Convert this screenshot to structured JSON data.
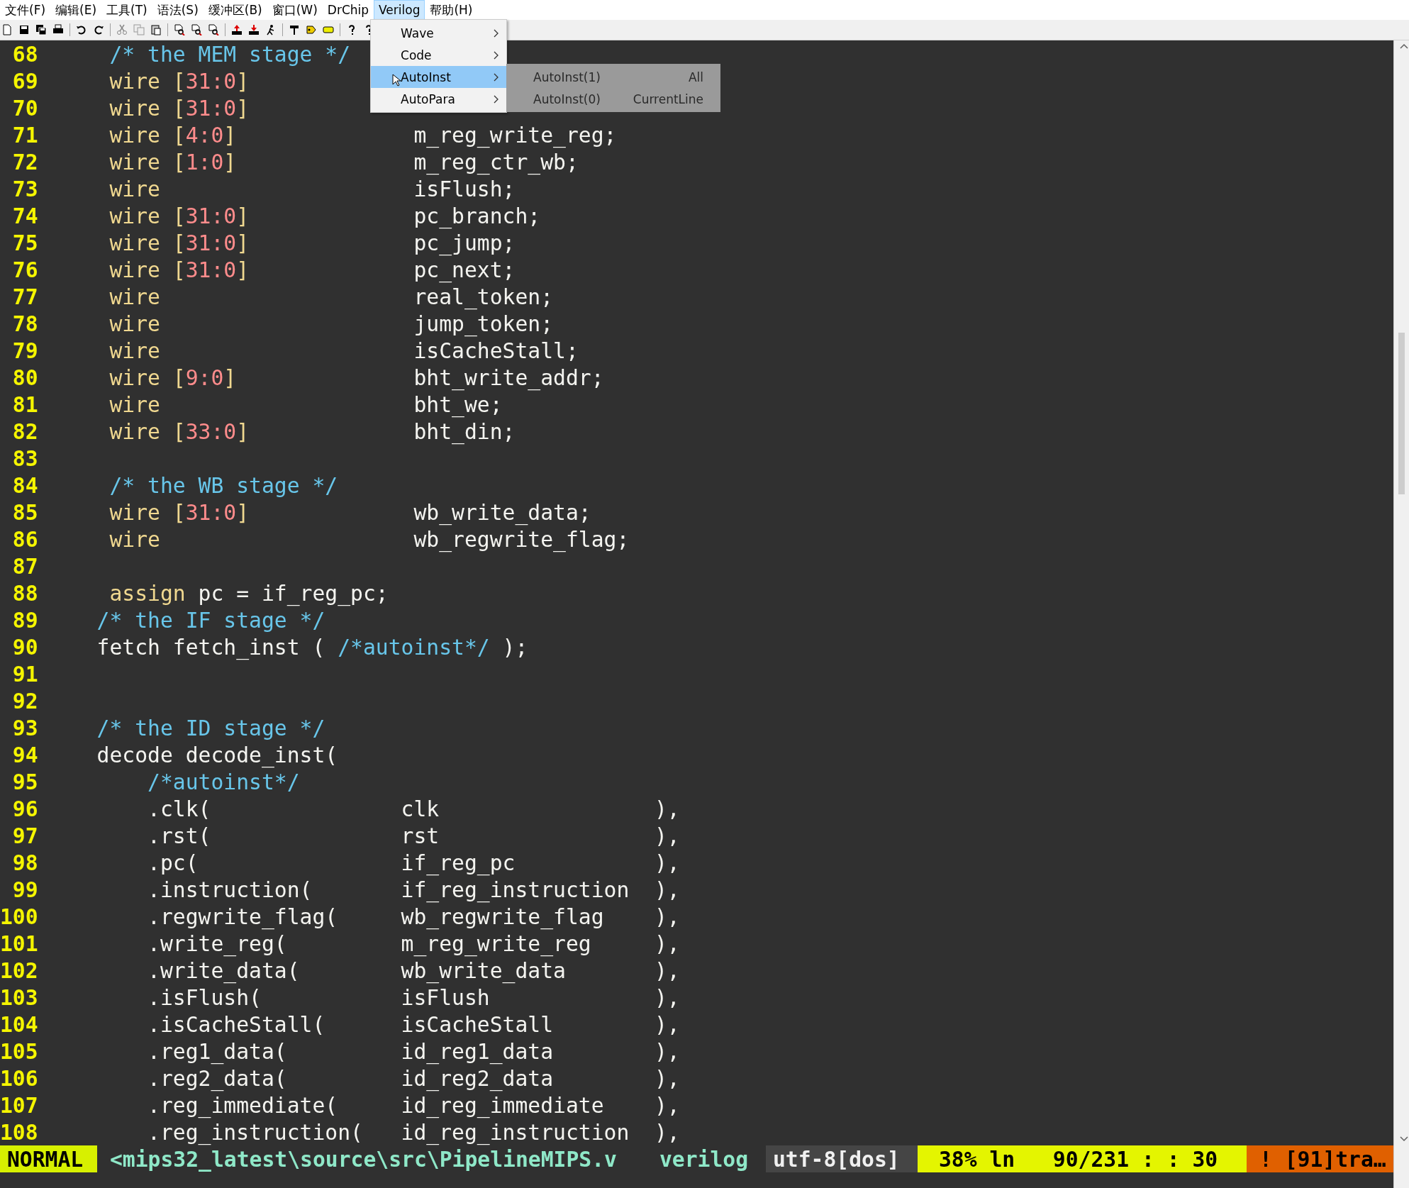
{
  "menu_bar": [
    {
      "label": "文件(F)",
      "selected": false
    },
    {
      "label": "编辑(E)",
      "selected": false
    },
    {
      "label": "工具(T)",
      "selected": false
    },
    {
      "label": "语法(S)",
      "selected": false
    },
    {
      "label": "缓冲区(B)",
      "selected": false
    },
    {
      "label": "窗口(W)",
      "selected": false
    },
    {
      "label": "DrChip",
      "selected": false
    },
    {
      "label": "Verilog",
      "selected": true,
      "items": [
        {
          "label": "Wave",
          "selected": false
        },
        {
          "label": "Code",
          "selected": false
        },
        {
          "label": "AutoInst",
          "selected": true,
          "submenu": [
            {
              "label": "AutoInst(1)",
              "detail": "All",
              "selected": false
            },
            {
              "label": "AutoInst(0)",
              "detail": "CurrentLine",
              "selected": false
            }
          ]
        },
        {
          "label": "AutoPara",
          "selected": false
        }
      ]
    },
    {
      "label": "帮助(H)",
      "selected": false
    }
  ],
  "editor": {
    "lines": [
      {
        "number": "68",
        "kind": "statement",
        "segments": [
          {
            "kind": "comment",
            "text": " /* the MEM stage */"
          }
        ]
      },
      {
        "number": "69",
        "kind": "declaration",
        "type": " wire",
        "range": "[31:0]"
      },
      {
        "number": "70",
        "kind": "declaration",
        "type": " wire",
        "range": "[31:0]"
      },
      {
        "number": "71",
        "kind": "declaration",
        "type": " wire",
        "range": "[4:0]",
        "name": "m_reg_write_reg;"
      },
      {
        "number": "72",
        "kind": "declaration",
        "type": " wire",
        "range": "[1:0]",
        "name": "m_reg_ctr_wb;"
      },
      {
        "number": "73",
        "kind": "declaration",
        "type": " wire",
        "name": "isFlush;"
      },
      {
        "number": "74",
        "kind": "declaration",
        "type": " wire",
        "range": "[31:0]",
        "name": "pc_branch;"
      },
      {
        "number": "75",
        "kind": "declaration",
        "type": " wire",
        "range": "[31:0]",
        "name": "pc_jump;"
      },
      {
        "number": "76",
        "kind": "declaration",
        "type": " wire",
        "range": "[31:0]",
        "name": "pc_next;"
      },
      {
        "number": "77",
        "kind": "declaration",
        "type": " wire",
        "name": "real_token;"
      },
      {
        "number": "78",
        "kind": "declaration",
        "type": " wire",
        "name": "jump_token;"
      },
      {
        "number": "79",
        "kind": "declaration",
        "type": " wire",
        "name": "isCacheStall;"
      },
      {
        "number": "80",
        "kind": "declaration",
        "type": " wire",
        "range": "[9:0]",
        "name": "bht_write_addr;"
      },
      {
        "number": "81",
        "kind": "declaration",
        "type": " wire",
        "name": "bht_we;"
      },
      {
        "number": "82",
        "kind": "declaration",
        "type": " wire",
        "range": "[33:0]",
        "name": "bht_din;"
      },
      {
        "number": "83",
        "kind": "blank"
      },
      {
        "number": "84",
        "kind": "statement",
        "segments": [
          {
            "kind": "comment",
            "text": " /* the WB stage */"
          }
        ]
      },
      {
        "number": "85",
        "kind": "declaration",
        "type": " wire",
        "range": "[31:0]",
        "name": "wb_write_data;"
      },
      {
        "number": "86",
        "kind": "declaration",
        "type": " wire",
        "name": "wb_regwrite_flag;"
      },
      {
        "number": "87",
        "kind": "blank"
      },
      {
        "number": "88",
        "kind": "statement",
        "segments": [
          {
            "kind": "keyword",
            "text": " assign"
          },
          {
            "kind": "plain",
            "text": "pc = if_reg_pc;"
          }
        ]
      },
      {
        "number": "89",
        "kind": "statement",
        "segments": [
          {
            "kind": "comment",
            "text": "/* the IF stage */"
          }
        ]
      },
      {
        "number": "90",
        "kind": "statement",
        "segments": [
          {
            "kind": "plain",
            "text": "fetch fetch_inst ("
          },
          {
            "kind": "comment",
            "text": "/*autoinst*/"
          },
          {
            "kind": "plain",
            "text": ");"
          }
        ]
      },
      {
        "number": "91",
        "kind": "blank"
      },
      {
        "number": "92",
        "kind": "blank"
      },
      {
        "number": "93",
        "kind": "statement",
        "segments": [
          {
            "kind": "comment",
            "text": "/* the ID stage */"
          }
        ]
      },
      {
        "number": "94",
        "kind": "statement",
        "segments": [
          {
            "kind": "plain",
            "text": "decode decode_inst("
          }
        ]
      },
      {
        "number": "95",
        "kind": "statement",
        "segments": [
          {
            "kind": "comment",
            "text": "    /*autoinst*/"
          }
        ]
      },
      {
        "number": "96",
        "kind": "port",
        "port": ".clk(",
        "signal": "clk",
        "close": "),"
      },
      {
        "number": "97",
        "kind": "port",
        "port": ".rst(",
        "signal": "rst",
        "close": "),"
      },
      {
        "number": "98",
        "kind": "port",
        "port": ".pc(",
        "signal": "if_reg_pc",
        "close": "),"
      },
      {
        "number": "99",
        "kind": "port",
        "port": ".instruction(",
        "signal": "if_reg_instruction",
        "close": "),"
      },
      {
        "number": "100",
        "kind": "port",
        "port": ".regwrite_flag(",
        "signal": "wb_regwrite_flag",
        "close": "),"
      },
      {
        "number": "101",
        "kind": "port",
        "port": ".write_reg(",
        "signal": "m_reg_write_reg",
        "close": "),"
      },
      {
        "number": "102",
        "kind": "port",
        "port": ".write_data(",
        "signal": "wb_write_data",
        "close": "),"
      },
      {
        "number": "103",
        "kind": "port",
        "port": ".isFlush(",
        "signal": "isFlush",
        "close": "),"
      },
      {
        "number": "104",
        "kind": "port",
        "port": ".isCacheStall(",
        "signal": "isCacheStall",
        "close": "),"
      },
      {
        "number": "105",
        "kind": "port",
        "port": ".reg1_data(",
        "signal": "id_reg1_data",
        "close": "),"
      },
      {
        "number": "106",
        "kind": "port",
        "port": ".reg2_data(",
        "signal": "id_reg2_data",
        "close": "),"
      },
      {
        "number": "107",
        "kind": "port",
        "port": ".reg_immediate(",
        "signal": "id_reg_immediate",
        "close": "),"
      },
      {
        "number": "108",
        "kind": "port",
        "port": ".reg_instruction(",
        "signal": "id_reg_instruction",
        "close": "),"
      }
    ]
  },
  "status_bar": [
    {
      "kind": "mode",
      "text": "NORMAL"
    },
    {
      "kind": "file",
      "text": "<mips32_latest\\source\\src\\PipelineMIPS.v"
    },
    {
      "kind": "filetype",
      "text": "verilog"
    },
    {
      "kind": "encoding",
      "text": "utf-8[dos]"
    },
    {
      "kind": "position",
      "text": "38% ln   90/231 : : 30"
    },
    {
      "kind": "warning",
      "text": "! [91]tra…"
    }
  ]
}
